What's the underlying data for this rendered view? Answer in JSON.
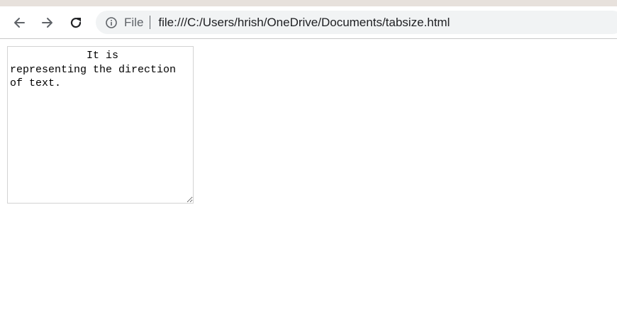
{
  "toolbar": {
    "back_icon": "arrow-left-icon",
    "forward_icon": "arrow-right-icon",
    "reload_icon": "reload-icon"
  },
  "omnibox": {
    "info_icon": "info-circle-icon",
    "scheme_label": "File",
    "url": "file:///C:/Users/hrish/OneDrive/Documents/tabsize.html"
  },
  "content": {
    "textarea_value": "\tIt is\nrepresenting the direction of text."
  },
  "colors": {
    "toolbar_icon": "#5f6368",
    "omnibox_bg": "#f1f3f4",
    "tabstrip": "#e7e1dc"
  }
}
